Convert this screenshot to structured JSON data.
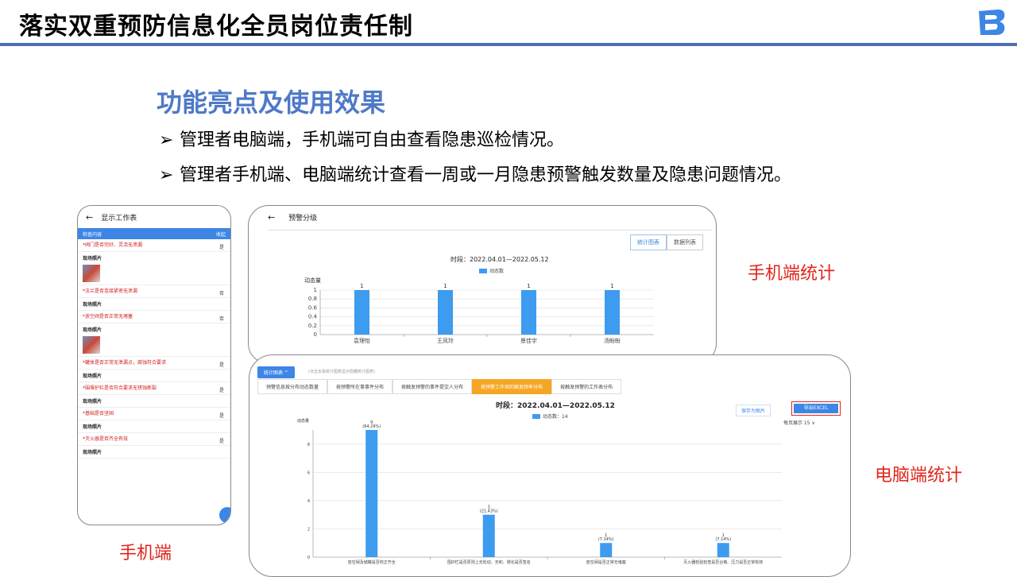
{
  "slide": {
    "title": "落实双重预防信息化全员岗位责任制",
    "subtitle": "功能亮点及使用效果",
    "bullets": [
      "管理者电脑端，手机端可自由查看隐患巡检情况。",
      "管理者手机端、电脑端统计查看一周或一月隐患预警触发数量及隐患问题情况。"
    ],
    "bullet_marker": "➢",
    "labels": {
      "mobile_stats": "手机端统计",
      "pc_stats": "电脑端统计",
      "mobile": "手机端"
    },
    "colors": {
      "title_bar": "#4a6fb5",
      "subtitle": "#4f79c8",
      "label_red": "#e0251b",
      "bar": "#3d9bf0"
    }
  },
  "phone": {
    "title": "显示工作表",
    "back_icon": "←",
    "header_left": "检查内容",
    "header_right": "收起",
    "photo_label": "现场照片",
    "items": [
      {
        "q": "阀门是否完好、灵活无泄漏",
        "v": "是"
      },
      {
        "q": "法兰是否连接紧密无泄漏",
        "v": "否"
      },
      {
        "q": "放空阀是否正常无堵塞",
        "v": "否"
      },
      {
        "q": "罐体是否正常无泄漏点，腐蚀符合要求",
        "v": "是"
      },
      {
        "q": "围堰护栏是否符合要求无锈蚀断裂",
        "v": "是"
      },
      {
        "q": "基础是否坚固",
        "v": "是"
      },
      {
        "q": "灭火器是否齐全有效",
        "v": "是"
      }
    ]
  },
  "tablet": {
    "title": "预警分级",
    "back_icon": "←",
    "btn_chart": "统计图表",
    "btn_list": "数据列表",
    "period": "时段：2022.04.01—2022.05.12",
    "legend": "动态数"
  },
  "desktop": {
    "btn": "统计图表 ^",
    "hint": "(点击去看统计图表显示隐藏统计图表)",
    "tabs": [
      "预警信息按分布动态数量",
      "按预警所在事事件分布",
      "按触发预警的事件提交人分布",
      "按预警工作项的触发频率分布",
      "按触发预警的工作表分布"
    ],
    "active_tab": 3,
    "save": "保存为图片",
    "export": "导出EXCEL",
    "per_page": "每页展示 15 ∨",
    "period": "时段：2022.04.01—2022.05.12",
    "legend": "动态数：14"
  },
  "chart_data": [
    {
      "type": "bar",
      "ylabel": "动态量",
      "categories": [
        "袁理怡",
        "王凤玲",
        "景佳宇",
        "汤盼盼"
      ],
      "values": [
        1,
        1,
        1,
        1
      ],
      "ylim": [
        0,
        1
      ],
      "yticks": [
        0,
        0.2,
        0.4,
        0.6,
        0.8,
        1
      ],
      "series": [
        {
          "name": "动态数",
          "values": [
            1,
            1,
            1,
            1
          ]
        }
      ],
      "grid": true
    },
    {
      "type": "bar",
      "ylabel": "动态量",
      "categories": [
        "放空阀及储罐是否校正齐全",
        "围护栏是否原则上无松动、无积、锈化是否签名",
        "放空阀是否正常无堵塞",
        "灭火器检验检查是否合格、压力是否正常有效"
      ],
      "values": [
        9,
        3,
        1,
        1
      ],
      "labels": [
        "9\n(64.29%)",
        "3\n(21.43%)",
        "1\n(7.14%)",
        "1\n(7.14%)"
      ],
      "ylim": [
        0,
        9
      ],
      "yticks": [
        0,
        2,
        4,
        6,
        8
      ],
      "series": [
        {
          "name": "动态数",
          "values": [
            9,
            3,
            1,
            1
          ]
        }
      ],
      "grid": true
    }
  ]
}
